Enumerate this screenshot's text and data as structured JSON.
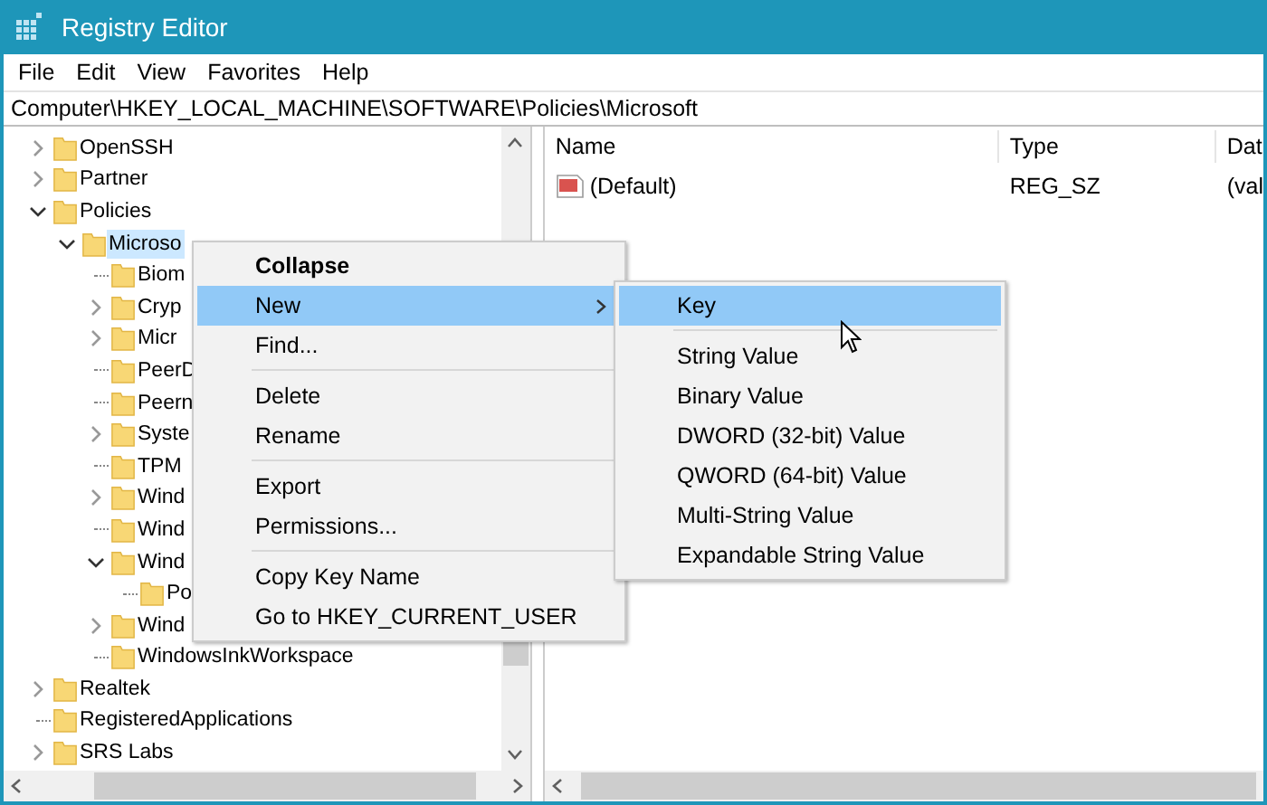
{
  "window": {
    "title": "Registry Editor"
  },
  "menu_bar": [
    "File",
    "Edit",
    "View",
    "Favorites",
    "Help"
  ],
  "address_bar": {
    "value": "Computer\\HKEY_LOCAL_MACHINE\\SOFTWARE\\Policies\\Microsoft"
  },
  "tree": [
    {
      "label": "OpenSSH",
      "kind": "branch",
      "expanded": false,
      "selected": false
    },
    {
      "label": "Partner",
      "kind": "branch",
      "expanded": false,
      "selected": false
    },
    {
      "label": "Policies",
      "kind": "branch",
      "expanded": true,
      "selected": false,
      "children": [
        {
          "label": "Microso",
          "kind": "branch",
          "expanded": true,
          "selected": true,
          "children": [
            {
              "label": "Biom",
              "kind": "leaf",
              "selected": false
            },
            {
              "label": "Cryp",
              "kind": "branch",
              "expanded": false,
              "selected": false
            },
            {
              "label": "Micr",
              "kind": "branch",
              "expanded": false,
              "selected": false
            },
            {
              "label": "PeerD",
              "kind": "leaf",
              "selected": false
            },
            {
              "label": "Peern",
              "kind": "leaf",
              "selected": false
            },
            {
              "label": "Syste",
              "kind": "branch",
              "expanded": false,
              "selected": false
            },
            {
              "label": "TPM",
              "kind": "leaf",
              "selected": false
            },
            {
              "label": "Wind",
              "kind": "branch",
              "expanded": false,
              "selected": false
            },
            {
              "label": "Wind",
              "kind": "leaf",
              "selected": false
            },
            {
              "label": "Wind",
              "kind": "branch",
              "expanded": true,
              "selected": false,
              "children": [
                {
                  "label": "Po",
                  "kind": "leaf",
                  "selected": false
                }
              ]
            },
            {
              "label": "Wind",
              "kind": "branch",
              "expanded": false,
              "selected": false
            },
            {
              "label": "WindowsInkWorkspace",
              "kind": "leaf",
              "selected": false
            }
          ]
        }
      ]
    },
    {
      "label": "Realtek",
      "kind": "branch",
      "expanded": false,
      "selected": false
    },
    {
      "label": "RegisteredApplications",
      "kind": "leaf",
      "selected": false
    },
    {
      "label": "SRS Labs",
      "kind": "branch",
      "expanded": false,
      "selected": false
    }
  ],
  "values_table": {
    "columns": [
      "Name",
      "Type",
      "Dat"
    ],
    "rows": [
      {
        "cells": [
          "(Default)",
          "REG_SZ",
          "(val"
        ]
      }
    ]
  },
  "context_menu": {
    "items": [
      {
        "kind": "item",
        "label": "Collapse",
        "bold": true,
        "highlighted": false,
        "submenu": false
      },
      {
        "kind": "item",
        "label": "New",
        "bold": false,
        "highlighted": true,
        "submenu": true
      },
      {
        "kind": "item",
        "label": "Find...",
        "bold": false,
        "highlighted": false,
        "submenu": false
      },
      {
        "kind": "separator"
      },
      {
        "kind": "item",
        "label": "Delete",
        "bold": false,
        "highlighted": false,
        "submenu": false
      },
      {
        "kind": "item",
        "label": "Rename",
        "bold": false,
        "highlighted": false,
        "submenu": false
      },
      {
        "kind": "separator"
      },
      {
        "kind": "item",
        "label": "Export",
        "bold": false,
        "highlighted": false,
        "submenu": false
      },
      {
        "kind": "item",
        "label": "Permissions...",
        "bold": false,
        "highlighted": false,
        "submenu": false
      },
      {
        "kind": "separator"
      },
      {
        "kind": "item",
        "label": "Copy Key Name",
        "bold": false,
        "highlighted": false,
        "submenu": false
      },
      {
        "kind": "item",
        "label": "Go to HKEY_CURRENT_USER",
        "bold": false,
        "highlighted": false,
        "submenu": false
      }
    ]
  },
  "submenu": {
    "items": [
      {
        "kind": "item",
        "label": "Key",
        "highlighted": true
      },
      {
        "kind": "separator"
      },
      {
        "kind": "item",
        "label": "String Value",
        "highlighted": false
      },
      {
        "kind": "item",
        "label": "Binary Value",
        "highlighted": false
      },
      {
        "kind": "item",
        "label": "DWORD (32-bit) Value",
        "highlighted": false
      },
      {
        "kind": "item",
        "label": "QWORD (64-bit) Value",
        "highlighted": false
      },
      {
        "kind": "item",
        "label": "Multi-String Value",
        "highlighted": false
      },
      {
        "kind": "item",
        "label": "Expandable String Value",
        "highlighted": false
      }
    ]
  }
}
